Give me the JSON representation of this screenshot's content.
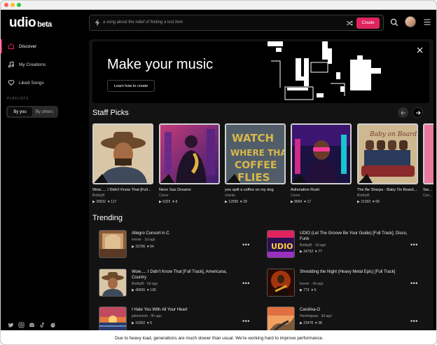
{
  "app": {
    "logo_text": "udio",
    "logo_badge": "beta"
  },
  "sidebar": {
    "items": [
      {
        "label": "Discover",
        "icon": "home-icon"
      },
      {
        "label": "My Creations",
        "icon": "music-note-icon"
      },
      {
        "label": "Liked Songs",
        "icon": "heart-icon"
      }
    ],
    "playlists_label": "PLAYLISTS",
    "toggle": {
      "by_you": "By you",
      "by_others": "By others",
      "selected": "By you"
    },
    "socials": [
      "twitter-icon",
      "instagram-icon",
      "discord-icon",
      "tiktok-icon",
      "reddit-icon"
    ]
  },
  "topbar": {
    "search_placeholder": "a song about the relief of finding a lost item",
    "create_label": "Create"
  },
  "banner": {
    "title": "Make your music",
    "button_label": "Learn how to create"
  },
  "staff_picks": {
    "title": "Staff Picks",
    "cards": [
      {
        "title": "Wow..... I Didn't Know That [Full...",
        "artist": "BobbyB",
        "plays": "39932",
        "likes": "117",
        "art": "cowboy"
      },
      {
        "title": "Neon Sax Dreams",
        "artist": "Conor",
        "plays": "6325",
        "likes": "8",
        "art": "sax"
      },
      {
        "title": "you spilt a coffee on my dog",
        "artist": "charlie",
        "plays": "12585",
        "likes": "28",
        "art": "graffiti"
      },
      {
        "title": "Adrenaline Rush",
        "artist": "Conor",
        "plays": "8684",
        "likes": "17",
        "art": "neon"
      },
      {
        "title": "The Be Sharps - Baby On Board,...",
        "artist": "BobbyB",
        "plays": "21393",
        "likes": "68",
        "art": "band"
      },
      {
        "title": "Sw...",
        "artist": "Con...",
        "plays": "",
        "likes": "",
        "art": "partial"
      }
    ]
  },
  "trending": {
    "title": "Trending",
    "tracks": [
      {
        "title": "Allegro Consort in C",
        "artist": "Inever",
        "age": "1d ago",
        "plays": "15706",
        "likes": "64",
        "art": "hall"
      },
      {
        "title": "UDIO (Let The Groove Be Your Guide) [Full Track], Disco, Funk",
        "artist": "BobbyB",
        "age": "2d ago",
        "plays": "24752",
        "likes": "77",
        "art": "udio"
      },
      {
        "title": "Wow..... I Didn't Know That [Full Track], Americana, Country",
        "artist": "BobbyB",
        "age": "6d ago",
        "plays": "40665",
        "likes": "136",
        "art": "cowboy"
      },
      {
        "title": "Shredding the Night (Heavy Metal Epic) [Full Track]",
        "artist": "Inever",
        "age": "4d ago",
        "plays": "773",
        "likes": "6",
        "art": "guitar"
      },
      {
        "title": "I Hate You With All Your Heart",
        "artist": "jakemarsh",
        "age": "9h ago",
        "plays": "10302",
        "likes": "6",
        "art": "sunset"
      },
      {
        "title": "Carolina-O",
        "artist": "Hemingway",
        "age": "3d ago",
        "plays": "23478",
        "likes": "38",
        "art": "road"
      }
    ]
  },
  "notice": "Due to heavy load, generations are much slower than usual. We're working hard to improve performance.",
  "colors": {
    "accent": "#e0245e",
    "background": "#000000",
    "panel": "#131313"
  }
}
